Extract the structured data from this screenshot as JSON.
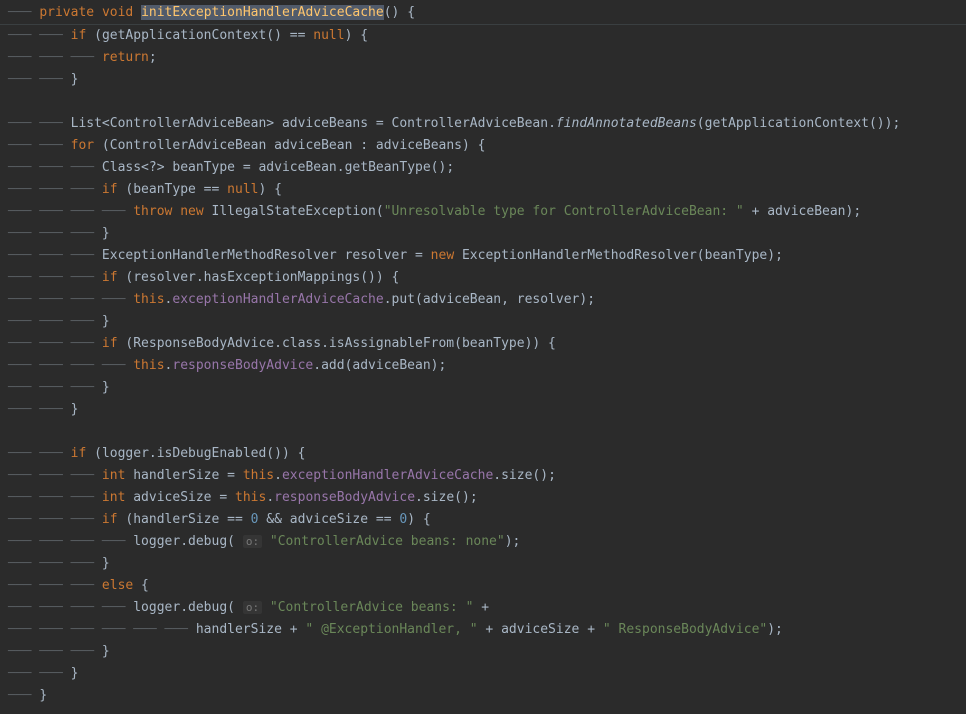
{
  "code": {
    "kw_private": "private",
    "kw_void": "void",
    "method_name": "initExceptionHandlerAdviceCache",
    "paren_open_brace": "() {",
    "kw_if": "if",
    "kw_return": "return",
    "kw_for": "for",
    "kw_throw": "throw",
    "kw_new": "new",
    "kw_this": "this",
    "kw_else": "else",
    "kw_null": "null",
    "kw_int": "int",
    "getAppCtx": "getApplicationContext()",
    "eq_null": " == ",
    "close_brace": "}",
    "open_brace": "{",
    "list_type": "List<ControllerAdviceBean>",
    "adviceBeans": "adviceBeans",
    "assign": " = ",
    "controllerAdviceBean": "ControllerAdviceBean",
    "findAnnotated": "findAnnotatedBeans",
    "adviceBean": "adviceBean",
    "for_in": " : ",
    "class_wild": "Class<?>",
    "beanType": "beanType",
    "getBeanType": ".getBeanType();",
    "illegalState": "IllegalStateException",
    "str_unresolvable": "\"Unresolvable type for ControllerAdviceBean: \"",
    "plus": " + ",
    "ehm_resolver": "ExceptionHandlerMethodResolver",
    "resolver": "resolver",
    "hasExcMappings": ".hasExceptionMappings()) {",
    "excHandlerCache": "exceptionHandlerAdviceCache",
    "put_call": ".put(adviceBean, resolver);",
    "responseBodyAdvice_class": "ResponseBodyAdvice",
    "class_isAssignable": ".class.isAssignableFrom(beanType)) {",
    "responseBodyAdvice_field": "responseBodyAdvice",
    "add_call": ".add(adviceBean);",
    "logger": "logger",
    "isDebugEnabled": ".isDebugEnabled()) {",
    "handlerSize": "handlerSize",
    "adviceSize": "adviceSize",
    "size_call": ".size();",
    "eq_zero": " == ",
    "zero": "0",
    "and": " && ",
    "debug_call": ".debug(",
    "o_hint": "o:",
    "str_none": "\"ControllerAdvice beans: none\"",
    "str_beans": "\"ControllerAdvice beans: \"",
    "str_excHandler": "\" @ExceptionHandler, \"",
    "str_respBody": "\" ResponseBodyAdvice\"",
    "semi": ";",
    "paren_close_semi": ");",
    "paren_open": "(",
    "paren_close": ")",
    "dot": "."
  },
  "guides": {
    "g1": "─── ",
    "g2": "─── ─── ",
    "g3": "─── ─── ─── ",
    "g4": "─── ─── ─── ─── ",
    "g5": "─── ─── ─── ─── ─── ",
    "g6": "─── ─── ─── ─── ─── ─── "
  }
}
